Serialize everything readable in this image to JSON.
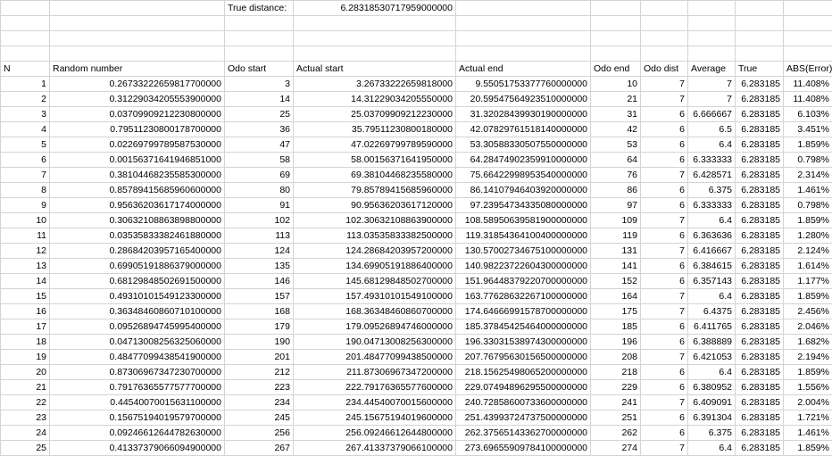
{
  "summary": {
    "label": "True distance:",
    "value": "6.28318530717959000000"
  },
  "headers": [
    "N",
    "Random number",
    "Odo start",
    "Actual start",
    "Actual end",
    "Odo end",
    "Odo dist",
    "Average",
    "True",
    "ABS(Error)"
  ],
  "rows": [
    [
      "1",
      "0.26733222659817700000",
      "3",
      "3.26733222659818000",
      "9.55051753377760000000",
      "10",
      "7",
      "7",
      "6.283185",
      "11.408%"
    ],
    [
      "2",
      "0.31229034205553900000",
      "14",
      "14.31229034205550000",
      "20.59547564923510000000",
      "21",
      "7",
      "7",
      "6.283185",
      "11.408%"
    ],
    [
      "3",
      "0.03709909212230800000",
      "25",
      "25.03709909212230000",
      "31.32028439930190000000",
      "31",
      "6",
      "6.666667",
      "6.283185",
      "6.103%"
    ],
    [
      "4",
      "0.79511230800178700000",
      "36",
      "35.79511230800180000",
      "42.07829761518140000000",
      "42",
      "6",
      "6.5",
      "6.283185",
      "3.451%"
    ],
    [
      "5",
      "0.02269799789587530000",
      "47",
      "47.02269799789590000",
      "53.30588330507550000000",
      "53",
      "6",
      "6.4",
      "6.283185",
      "1.859%"
    ],
    [
      "6",
      "0.00156371641946851000",
      "58",
      "58.00156371641950000",
      "64.28474902359910000000",
      "64",
      "6",
      "6.333333",
      "6.283185",
      "0.798%"
    ],
    [
      "7",
      "0.38104468235585300000",
      "69",
      "69.38104468235580000",
      "75.66422998953540000000",
      "76",
      "7",
      "6.428571",
      "6.283185",
      "2.314%"
    ],
    [
      "8",
      "0.85789415685960600000",
      "80",
      "79.85789415685960000",
      "86.14107946403920000000",
      "86",
      "6",
      "6.375",
      "6.283185",
      "1.461%"
    ],
    [
      "9",
      "0.95636203617174000000",
      "91",
      "90.95636203617120000",
      "97.23954734335080000000",
      "97",
      "6",
      "6.333333",
      "6.283185",
      "0.798%"
    ],
    [
      "10",
      "0.30632108863898800000",
      "102",
      "102.30632108863900000",
      "108.58950639581900000000",
      "109",
      "7",
      "6.4",
      "6.283185",
      "1.859%"
    ],
    [
      "11",
      "0.03535833382461880000",
      "113",
      "113.03535833382500000",
      "119.31854364100400000000",
      "119",
      "6",
      "6.363636",
      "6.283185",
      "1.280%"
    ],
    [
      "12",
      "0.28684203957165400000",
      "124",
      "124.28684203957200000",
      "130.57002734675100000000",
      "131",
      "7",
      "6.416667",
      "6.283185",
      "2.124%"
    ],
    [
      "13",
      "0.69905191886379000000",
      "135",
      "134.69905191886400000",
      "140.98223722604300000000",
      "141",
      "6",
      "6.384615",
      "6.283185",
      "1.614%"
    ],
    [
      "14",
      "0.68129848502691500000",
      "146",
      "145.68129848502700000",
      "151.96448379220700000000",
      "152",
      "6",
      "6.357143",
      "6.283185",
      "1.177%"
    ],
    [
      "15",
      "0.49310101549123300000",
      "157",
      "157.49310101549100000",
      "163.77628632267100000000",
      "164",
      "7",
      "6.4",
      "6.283185",
      "1.859%"
    ],
    [
      "16",
      "0.36348460860710100000",
      "168",
      "168.36348460860700000",
      "174.64666991578700000000",
      "175",
      "7",
      "6.4375",
      "6.283185",
      "2.456%"
    ],
    [
      "17",
      "0.09526894745995400000",
      "179",
      "179.09526894746000000",
      "185.37845425464000000000",
      "185",
      "6",
      "6.411765",
      "6.283185",
      "2.046%"
    ],
    [
      "18",
      "0.04713008256325060000",
      "190",
      "190.04713008256300000",
      "196.33031538974300000000",
      "196",
      "6",
      "6.388889",
      "6.283185",
      "1.682%"
    ],
    [
      "19",
      "0.48477099438541900000",
      "201",
      "201.48477099438500000",
      "207.76795630156500000000",
      "208",
      "7",
      "6.421053",
      "6.283185",
      "2.194%"
    ],
    [
      "20",
      "0.87306967347230700000",
      "212",
      "211.87306967347200000",
      "218.15625498065200000000",
      "218",
      "6",
      "6.4",
      "6.283185",
      "1.859%"
    ],
    [
      "21",
      "0.79176365577577700000",
      "223",
      "222.79176365577600000",
      "229.07494896295500000000",
      "229",
      "6",
      "6.380952",
      "6.283185",
      "1.556%"
    ],
    [
      "22",
      "0.44540070015631100000",
      "234",
      "234.44540070015600000",
      "240.72858600733600000000",
      "241",
      "7",
      "6.409091",
      "6.283185",
      "2.004%"
    ],
    [
      "23",
      "0.15675194019579700000",
      "245",
      "245.15675194019600000",
      "251.43993724737500000000",
      "251",
      "6",
      "6.391304",
      "6.283185",
      "1.721%"
    ],
    [
      "24",
      "0.09246612644782630000",
      "256",
      "256.09246612644800000",
      "262.37565143362700000000",
      "262",
      "6",
      "6.375",
      "6.283185",
      "1.461%"
    ],
    [
      "25",
      "0.41337379066094900000",
      "267",
      "267.41337379066100000",
      "273.69655909784100000000",
      "274",
      "7",
      "6.4",
      "6.283185",
      "1.859%"
    ]
  ]
}
